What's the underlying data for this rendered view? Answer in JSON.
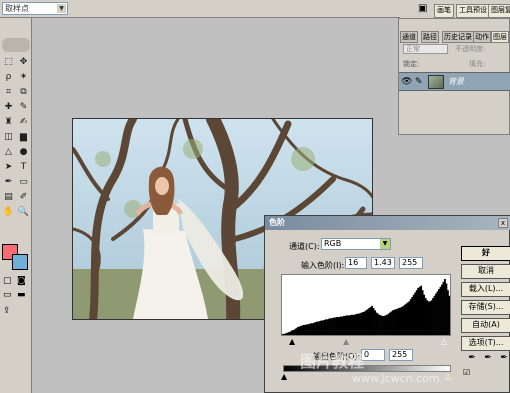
{
  "options_bar": {
    "sample_select": "取样点",
    "tabs": [
      "画笔",
      "工具预设",
      "图层复"
    ]
  },
  "toolbox": {
    "tools": [
      "marquee-icon",
      "move-icon",
      "lasso-icon",
      "magic-wand-icon",
      "crop-icon",
      "slice-icon",
      "healing-icon",
      "brush-icon",
      "stamp-icon",
      "history-brush-icon",
      "eraser-icon",
      "gradient-icon",
      "blur-icon",
      "dodge-icon",
      "path-select-icon",
      "type-icon",
      "pen-icon",
      "shape-icon",
      "notes-icon",
      "eyedropper-icon",
      "hand-icon",
      "zoom-icon"
    ],
    "tool_glyphs": [
      "⬚",
      "✥",
      "ρ",
      "✶",
      "⌗",
      "⧉",
      "✚",
      "✎",
      "♜",
      "✍",
      "◫",
      "▆",
      "△",
      "●",
      "➤",
      "T",
      "✒",
      "▭",
      "▤",
      "✐",
      "✋",
      "🔍"
    ],
    "foreground_color": "#f76c74",
    "background_color": "#6fb0d8"
  },
  "layers_panel": {
    "tabs": [
      "通道",
      "路径",
      "历史记录",
      "动作",
      "图层"
    ],
    "blend_mode": "正常",
    "opacity_label": "不透明度:",
    "lock_label": "锁定:",
    "fill_label": "填充:",
    "layer_name": "背景"
  },
  "levels_dialog": {
    "title": "色阶",
    "close": "x",
    "channel_label": "通道(C):",
    "channel_value": "RGB",
    "input_label": "输入色阶(I):",
    "input_black": "16",
    "input_gamma": "1.43",
    "input_white": "255",
    "output_label": "输出色阶(O):",
    "output_black": "0",
    "output_white": "255",
    "buttons": {
      "ok": "好",
      "cancel": "取消",
      "load": "载入(L)...",
      "save": "存储(S)...",
      "auto": "自动(A)",
      "options": "选项(T)..."
    },
    "histogram": [
      2,
      2,
      3,
      4,
      5,
      6,
      8,
      9,
      10,
      12,
      14,
      15,
      16,
      17,
      18,
      18,
      19,
      19,
      20,
      21,
      21,
      22,
      23,
      24,
      24,
      25,
      26,
      26,
      27,
      28,
      28,
      29,
      30,
      30,
      31,
      31,
      32,
      32,
      32,
      33,
      33,
      34,
      34,
      35,
      35,
      35,
      36,
      36,
      36,
      37,
      38,
      38,
      39,
      40,
      41,
      42,
      44,
      46,
      48,
      50,
      52,
      48,
      44,
      40,
      38,
      36,
      35,
      34,
      34,
      35,
      36,
      38,
      40,
      42,
      44,
      45,
      46,
      47,
      48,
      49,
      50,
      52,
      54,
      56,
      58,
      60,
      64,
      68,
      72,
      76,
      80,
      84,
      86,
      88,
      80,
      72,
      66,
      62,
      60,
      60,
      62,
      66,
      70,
      74,
      78,
      82,
      86,
      90,
      95,
      100,
      92,
      80,
      70
    ]
  },
  "watermark": {
    "text": "图片教程",
    "url": "www.jcwcn.com"
  }
}
